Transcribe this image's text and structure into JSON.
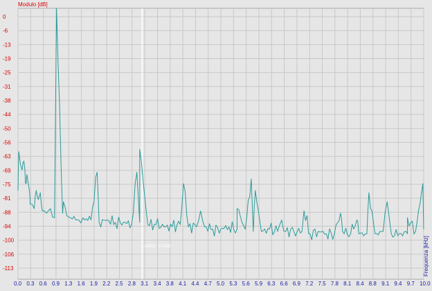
{
  "chart_data": {
    "type": "line",
    "ylabel": "Modulo [dB]",
    "xlabel": "Frequenza [kHz]",
    "y_ticks": [
      "0",
      "-6",
      "-13",
      "-19",
      "-25",
      "-31",
      "-38",
      "-44",
      "-50",
      "-56",
      "-63",
      "-69",
      "-75",
      "-81",
      "-88",
      "-94",
      "-100",
      "-106",
      "-113"
    ],
    "x_ticks": [
      "0.0",
      "0.3",
      "0.6",
      "0.9",
      "1.3",
      "1.6",
      "1.9",
      "2.2",
      "2.5",
      "2.8",
      "3.1",
      "3.4",
      "3.8",
      "4.1",
      "4.4",
      "4.7",
      "5.0",
      "5.3",
      "5.6",
      "5.9",
      "6.3",
      "6.6",
      "6.9",
      "7.2",
      "7.5",
      "7.8",
      "8.1",
      "8.4",
      "8.8",
      "9.1",
      "9.4",
      "9.7",
      "10.0"
    ],
    "xlim": [
      0.0,
      10.0
    ],
    "ylim": [
      -119.0,
      0.0
    ],
    "grid": true,
    "cursor": {
      "x": 3.06,
      "readout": "3.14kHz -107dB"
    },
    "colors": {
      "series": "#2a9a9a",
      "y_axis_text": "#d80000",
      "x_axis_text": "#1a1aa6",
      "plot_background": "#e6e6e6",
      "grid": "#c8c8c8",
      "cursor": "#ffffff"
    },
    "series": [
      {
        "noise_floor_points": [
          [
            0.0,
            -80
          ],
          [
            0.1,
            -71
          ],
          [
            0.2,
            -77
          ],
          [
            0.3,
            -86
          ],
          [
            0.4,
            -88
          ],
          [
            0.5,
            -84
          ],
          [
            0.6,
            -89
          ],
          [
            0.7,
            -90
          ],
          [
            0.8,
            -88
          ],
          [
            0.9,
            -92
          ],
          [
            1.1,
            -90
          ],
          [
            1.2,
            -91
          ],
          [
            1.3,
            -92
          ],
          [
            1.5,
            -93
          ],
          [
            1.6,
            -92
          ],
          [
            1.8,
            -93
          ],
          [
            2.0,
            -94
          ],
          [
            2.2,
            -93
          ],
          [
            2.4,
            -94
          ],
          [
            2.6,
            -94
          ],
          [
            2.8,
            -95
          ],
          [
            3.0,
            -94
          ],
          [
            3.2,
            -95
          ],
          [
            3.4,
            -95
          ],
          [
            3.6,
            -96
          ],
          [
            3.8,
            -96
          ],
          [
            4.0,
            -95
          ],
          [
            4.2,
            -96
          ],
          [
            4.4,
            -96
          ],
          [
            4.6,
            -96
          ],
          [
            4.8,
            -97
          ],
          [
            5.0,
            -97
          ],
          [
            5.2,
            -96
          ],
          [
            5.4,
            -97
          ],
          [
            5.6,
            -97
          ],
          [
            5.8,
            -98
          ],
          [
            6.0,
            -98
          ],
          [
            6.2,
            -97
          ],
          [
            6.4,
            -98
          ],
          [
            6.6,
            -98
          ],
          [
            6.8,
            -98
          ],
          [
            7.0,
            -98
          ],
          [
            7.2,
            -99
          ],
          [
            7.4,
            -98
          ],
          [
            7.6,
            -99
          ],
          [
            7.8,
            -99
          ],
          [
            8.0,
            -98
          ],
          [
            8.2,
            -99
          ],
          [
            8.4,
            -99
          ],
          [
            8.6,
            -99
          ],
          [
            8.8,
            -99
          ],
          [
            9.0,
            -98
          ],
          [
            9.2,
            -99
          ],
          [
            9.4,
            -99
          ],
          [
            9.6,
            -99
          ],
          [
            9.8,
            -98
          ],
          [
            10.0,
            -97
          ]
        ],
        "peaks": [
          [
            0.02,
            -63
          ],
          [
            0.12,
            -68
          ],
          [
            0.17,
            -71
          ],
          [
            0.22,
            -73
          ],
          [
            0.28,
            -80
          ],
          [
            0.45,
            -80
          ],
          [
            0.55,
            -81
          ],
          [
            0.95,
            0
          ],
          [
            1.12,
            -85
          ],
          [
            1.95,
            -72
          ],
          [
            2.93,
            -72
          ],
          [
            3.0,
            -62
          ],
          [
            4.08,
            -77
          ],
          [
            4.5,
            -89
          ],
          [
            5.4,
            -88
          ],
          [
            5.75,
            -75
          ],
          [
            5.85,
            -80
          ],
          [
            6.5,
            -93
          ],
          [
            7.05,
            -89
          ],
          [
            7.95,
            -90
          ],
          [
            8.35,
            -93
          ],
          [
            8.65,
            -81
          ],
          [
            9.1,
            -85
          ],
          [
            9.6,
            -92
          ],
          [
            9.98,
            -77
          ]
        ]
      }
    ]
  }
}
